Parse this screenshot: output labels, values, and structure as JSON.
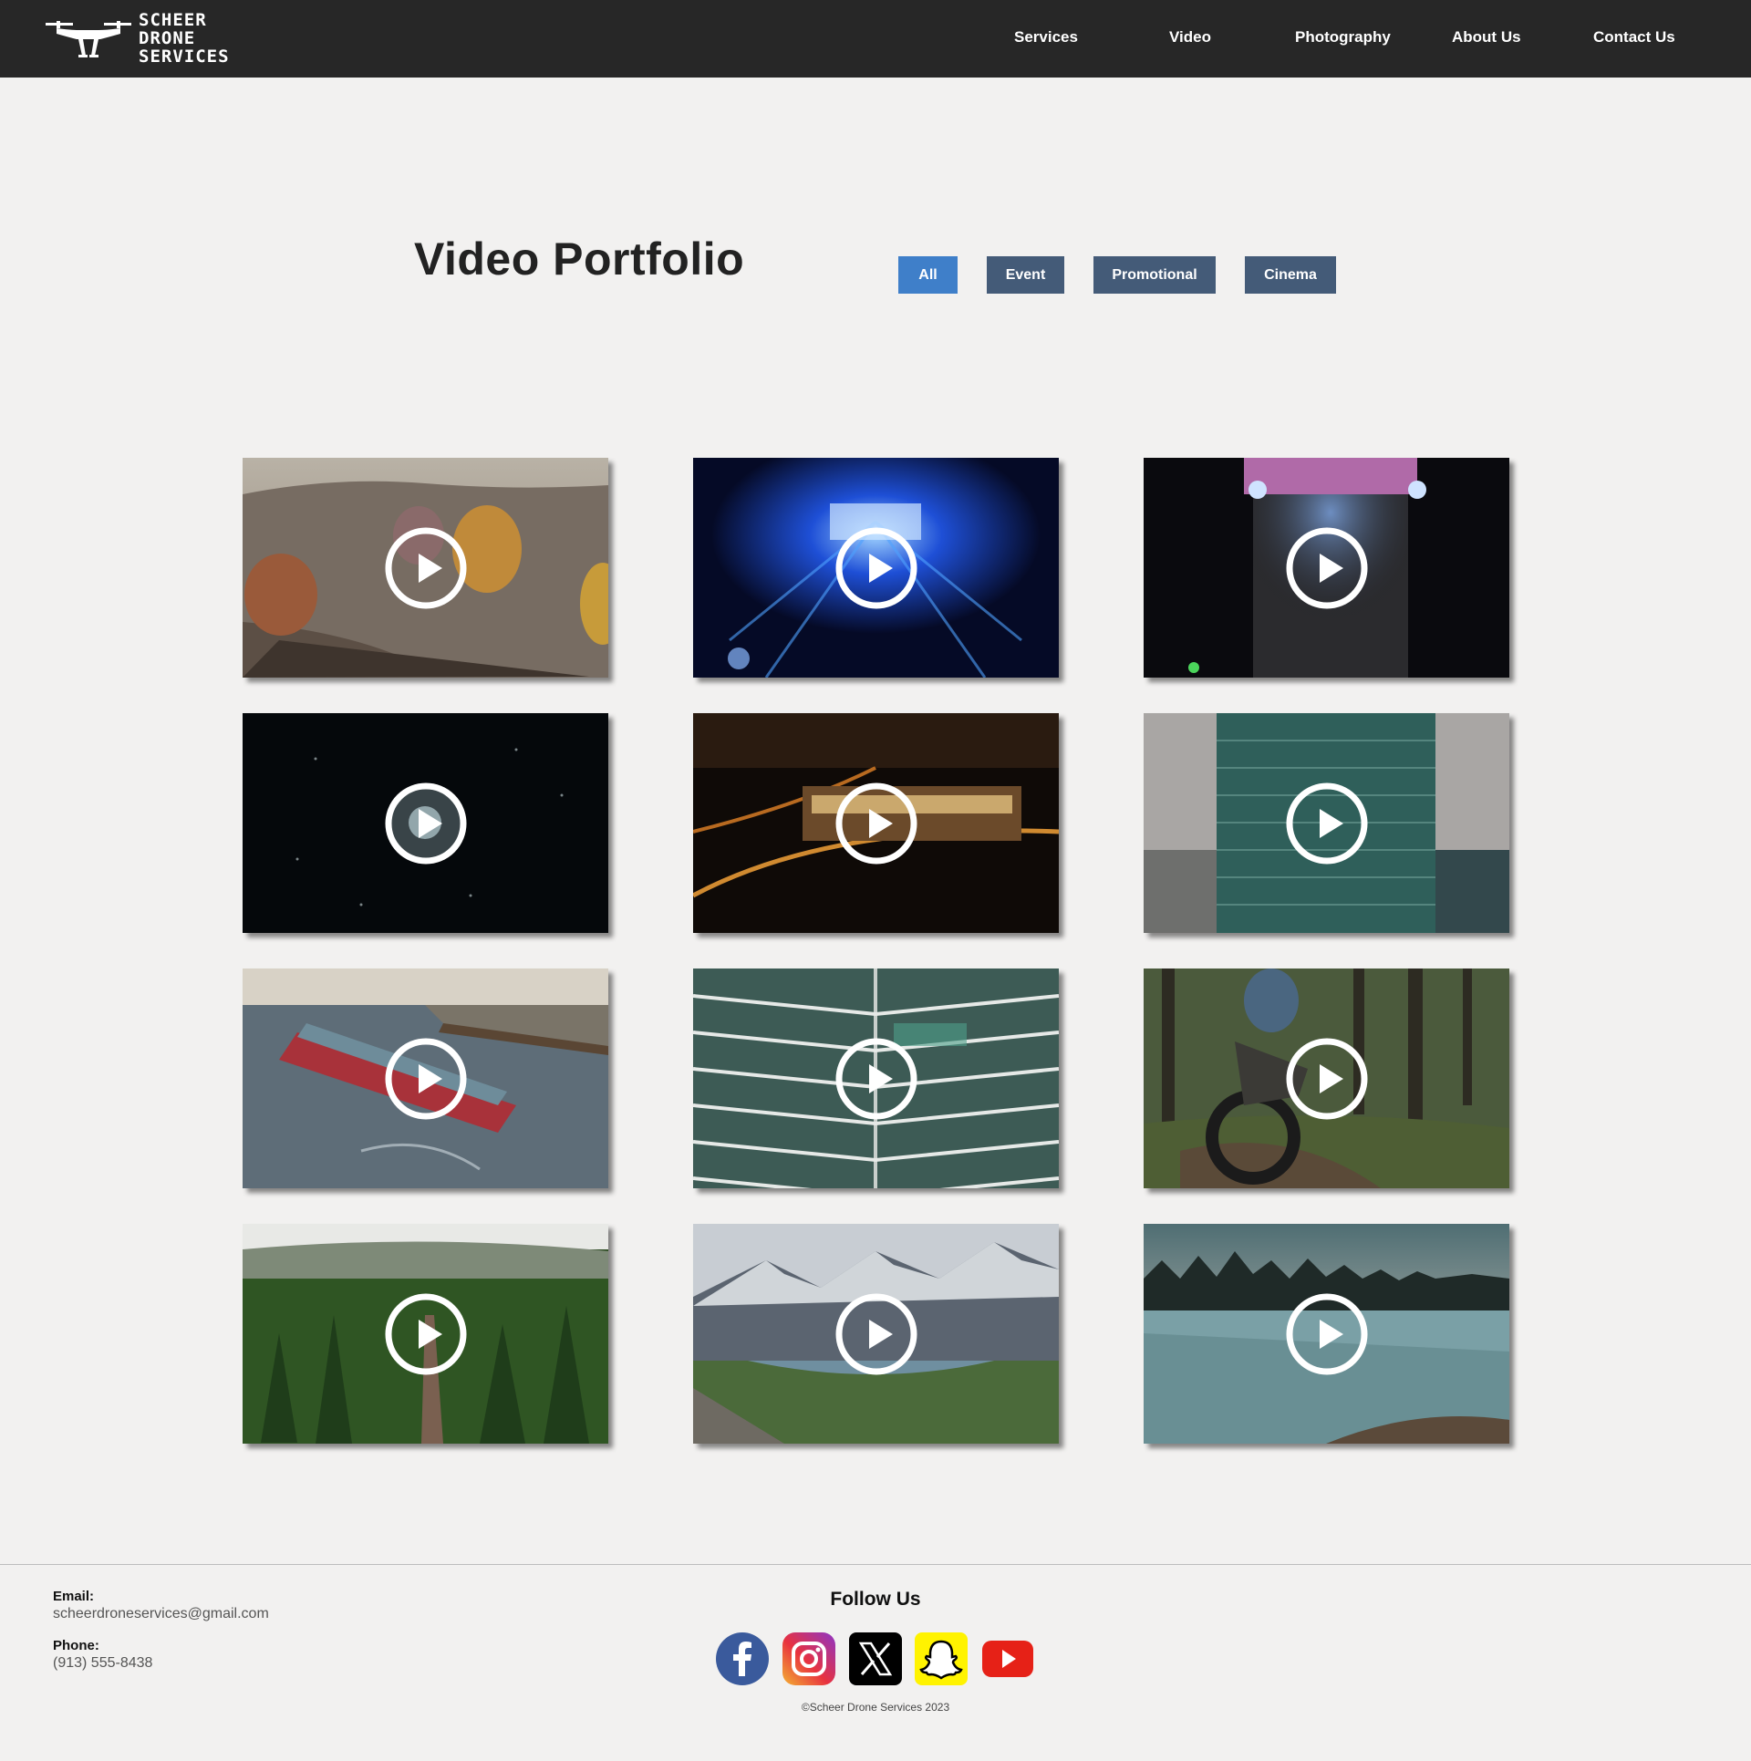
{
  "header": {
    "logo_lines": [
      "SCHEER",
      "DRONE",
      "SERVICES"
    ],
    "nav": [
      "Services",
      "Video",
      "Photography",
      "About Us",
      "Contact Us"
    ]
  },
  "main": {
    "title": "Video Portfolio",
    "filters": [
      {
        "label": "All",
        "active": true
      },
      {
        "label": "Event",
        "active": false
      },
      {
        "label": "Promotional",
        "active": false
      },
      {
        "label": "Cinema",
        "active": false
      }
    ],
    "videos": [
      {
        "scene": "hot air balloons over canyon at dawn"
      },
      {
        "scene": "aerial concert stage with blue lights"
      },
      {
        "scene": "top-down festival crowd at night"
      },
      {
        "scene": "fireworks over dark city"
      },
      {
        "scene": "illuminated building at night with roads"
      },
      {
        "scene": "glass skyscraper facade"
      },
      {
        "scene": "container ship with tugboats in harbor"
      },
      {
        "scene": "modern glass office building corner"
      },
      {
        "scene": "dirt bike rider in forest"
      },
      {
        "scene": "road through pine forest"
      },
      {
        "scene": "snowy mountains and valley"
      },
      {
        "scene": "snowy field with tree line at dusk"
      }
    ]
  },
  "footer": {
    "email_label": "Email:",
    "email": "scheerdroneservices@gmail.com",
    "phone_label": "Phone:",
    "phone": "(913) 555-8438",
    "follow_title": "Follow Us",
    "social": [
      "facebook",
      "instagram",
      "x",
      "snapchat",
      "youtube"
    ],
    "copyright": "©Scheer Drone Services 2023"
  },
  "colors": {
    "header_bg": "#272727",
    "page_bg": "#f2f1f0",
    "filter_active": "#3f7fc9",
    "filter_inactive": "#445b78"
  }
}
